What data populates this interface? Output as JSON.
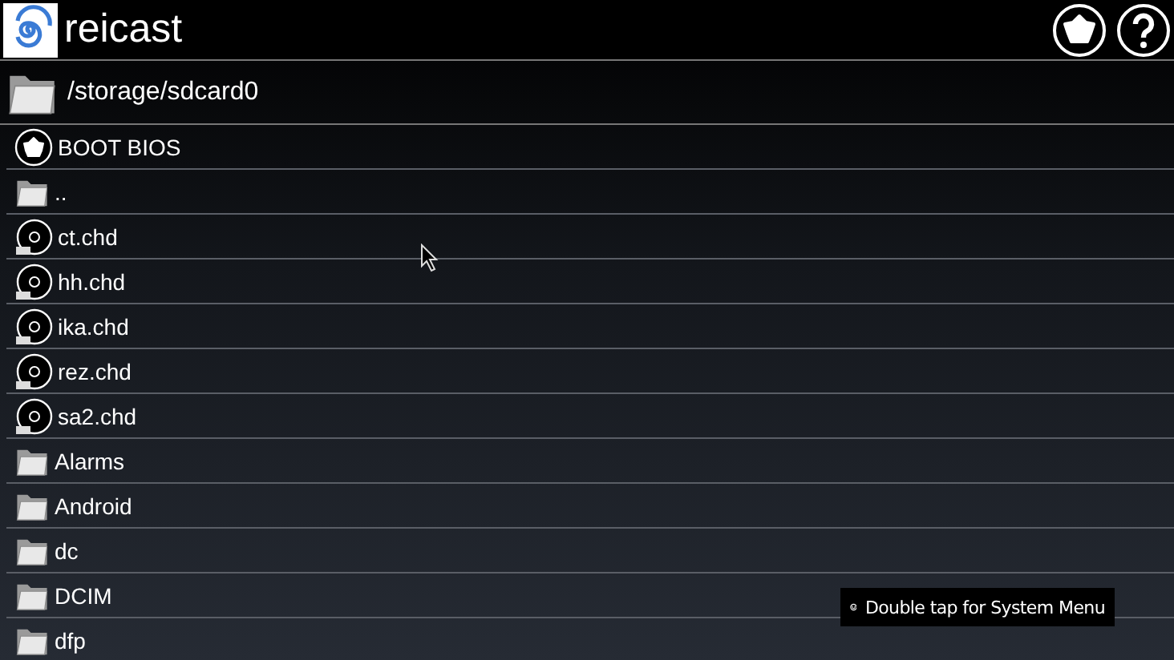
{
  "app_bar": {
    "title": "reicast"
  },
  "path": "/storage/sdcard0",
  "entries": [
    {
      "kind": "bios",
      "label": "BOOT BIOS"
    },
    {
      "kind": "folder",
      "label": ".."
    },
    {
      "kind": "disc",
      "label": "ct.chd"
    },
    {
      "kind": "disc",
      "label": "hh.chd"
    },
    {
      "kind": "disc",
      "label": "ika.chd"
    },
    {
      "kind": "disc",
      "label": "rez.chd"
    },
    {
      "kind": "disc",
      "label": "sa2.chd"
    },
    {
      "kind": "folder",
      "label": "Alarms"
    },
    {
      "kind": "folder",
      "label": "Android"
    },
    {
      "kind": "folder",
      "label": "dc"
    },
    {
      "kind": "folder",
      "label": "DCIM"
    },
    {
      "kind": "folder",
      "label": "dfp"
    }
  ],
  "toast": {
    "text": "Double tap for System Menu"
  }
}
